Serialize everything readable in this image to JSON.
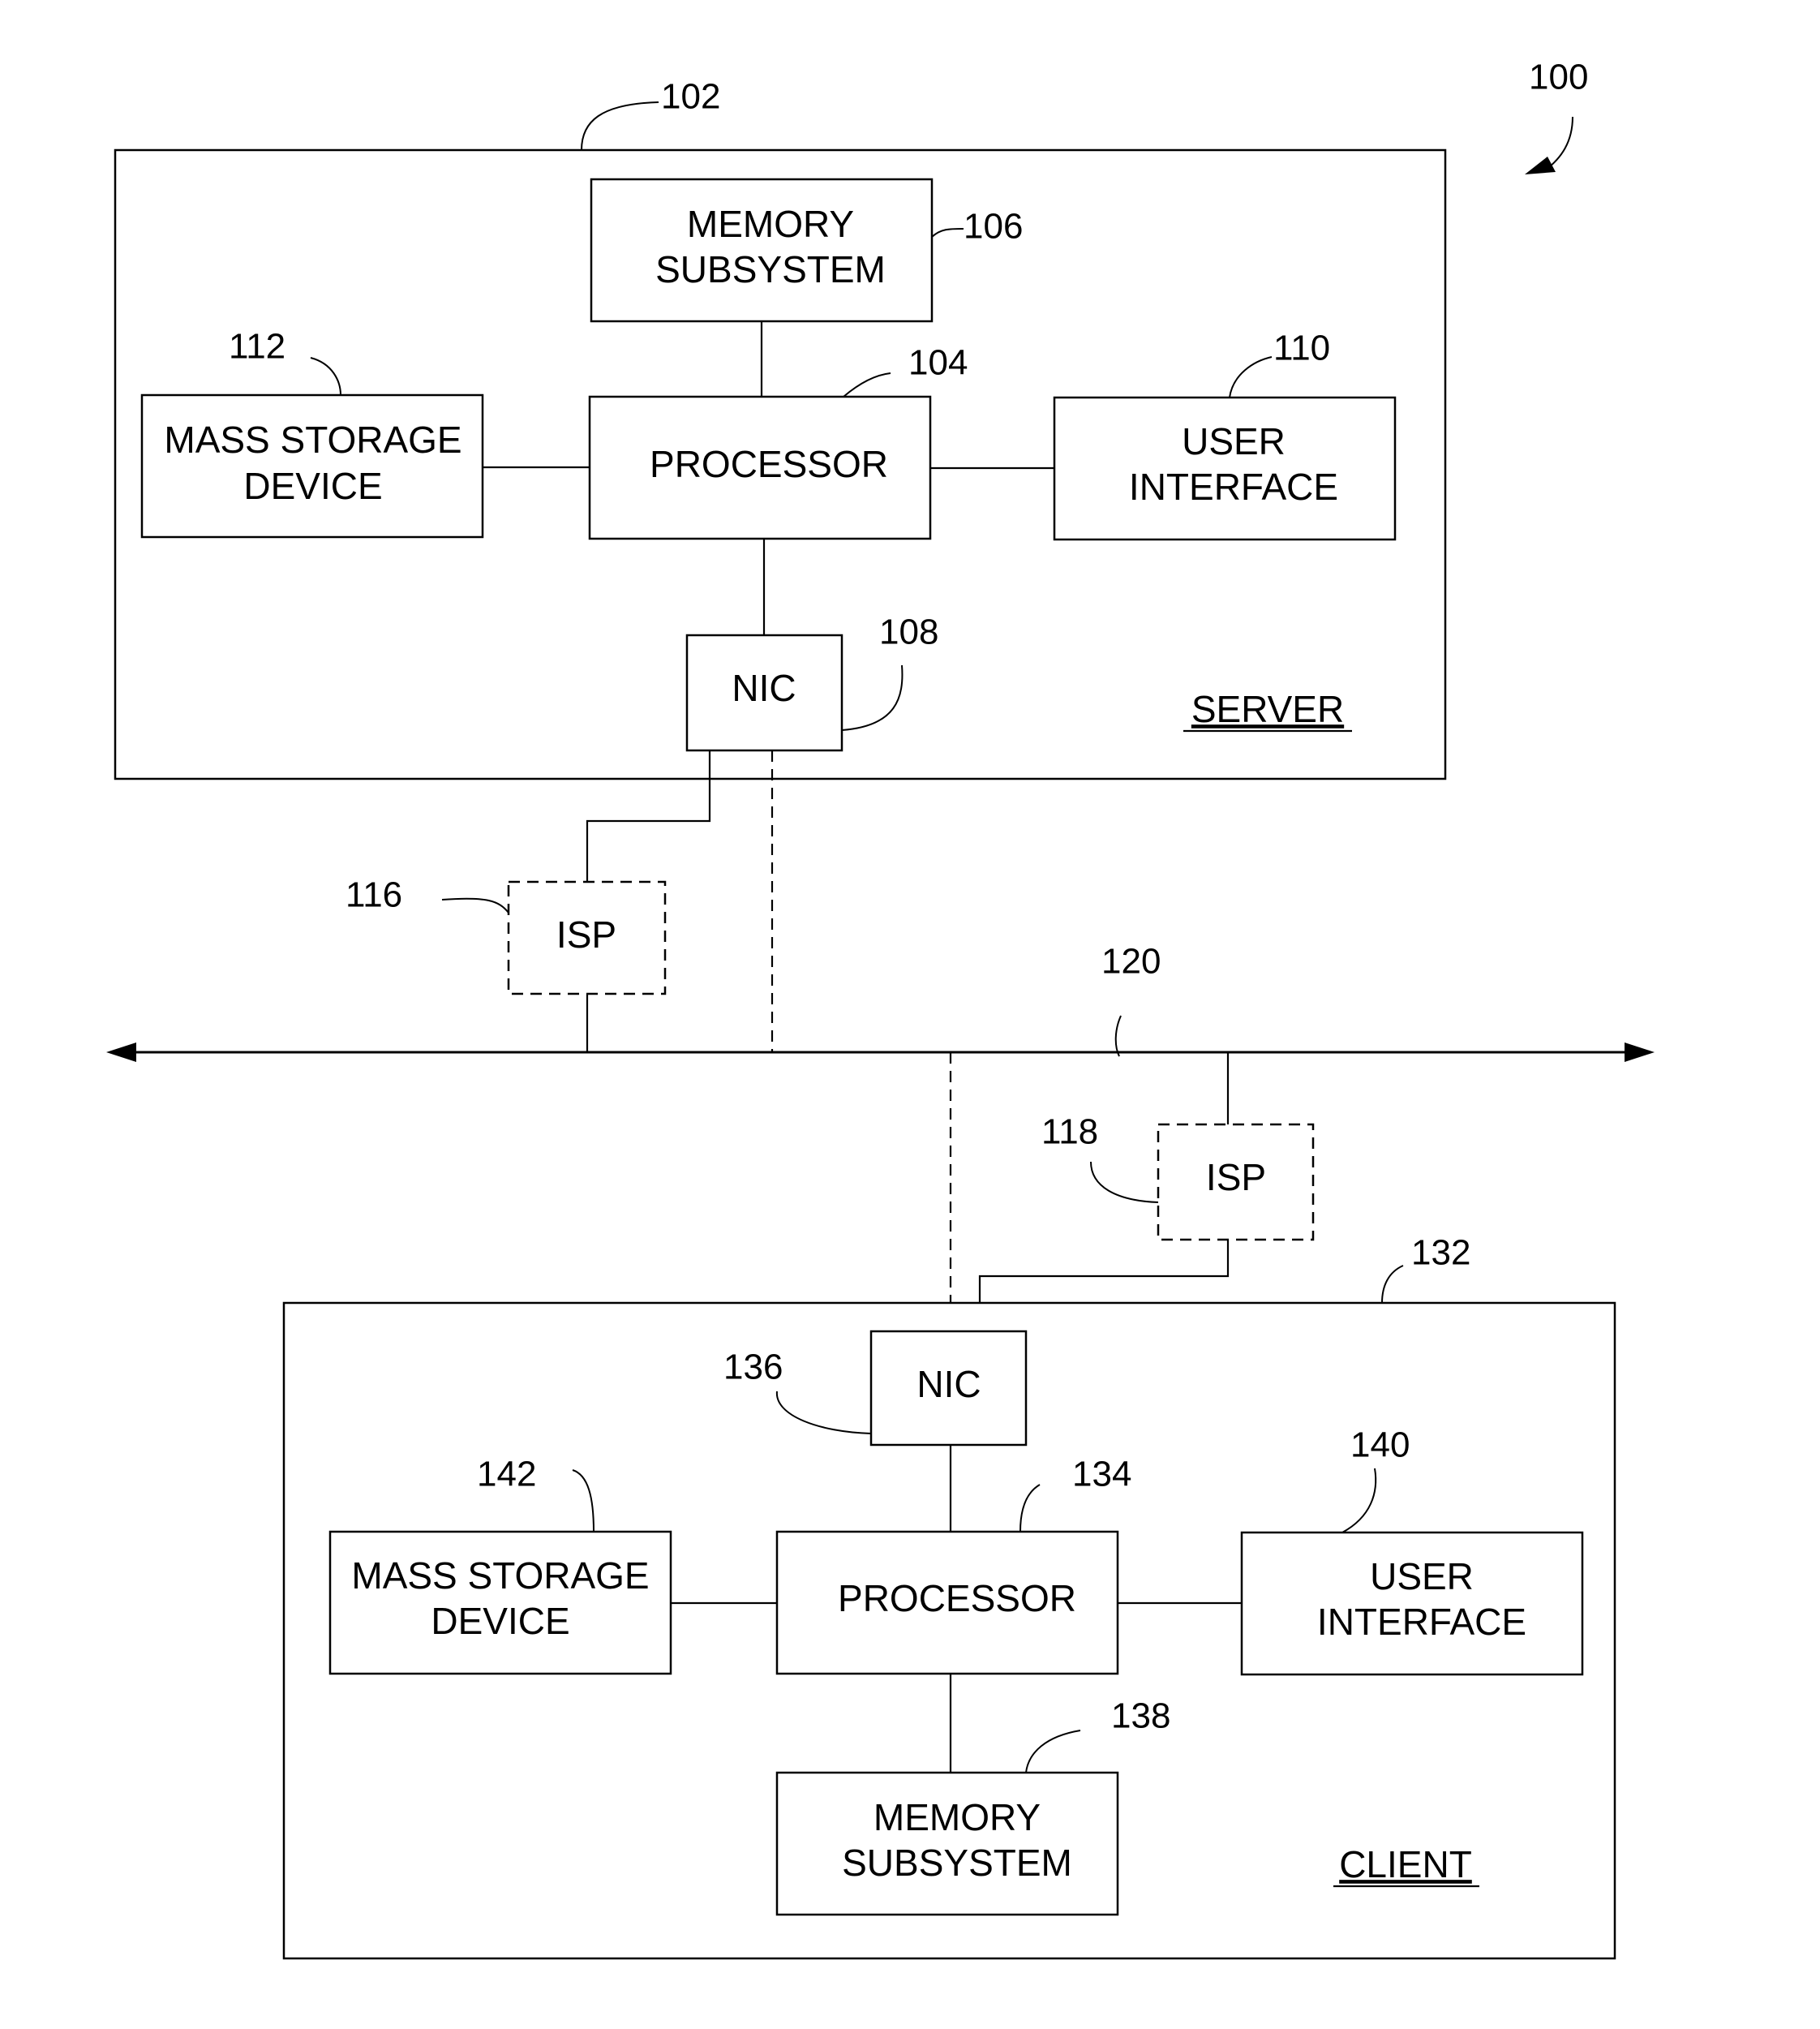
{
  "figure": {
    "ref": "100",
    "network_ref": "120"
  },
  "server": {
    "ref": "102",
    "title": "SERVER",
    "memory": {
      "ref": "106",
      "line1": "MEMORY",
      "line2": "SUBSYSTEM"
    },
    "processor": {
      "ref": "104",
      "label": "PROCESSOR"
    },
    "mass_storage": {
      "ref": "112",
      "line1": "MASS STORAGE",
      "line2": "DEVICE"
    },
    "user_interface": {
      "ref": "110",
      "line1": "USER",
      "line2": "INTERFACE"
    },
    "nic": {
      "ref": "108",
      "label": "NIC"
    }
  },
  "isp_server": {
    "ref": "116",
    "label": "ISP"
  },
  "isp_client": {
    "ref": "118",
    "label": "ISP"
  },
  "client": {
    "ref": "132",
    "title": "CLIENT",
    "nic": {
      "ref": "136",
      "label": "NIC"
    },
    "processor": {
      "ref": "134",
      "label": "PROCESSOR"
    },
    "mass_storage": {
      "ref": "142",
      "line1": "MASS STORAGE",
      "line2": "DEVICE"
    },
    "user_interface": {
      "ref": "140",
      "line1": "USER",
      "line2": "INTERFACE"
    },
    "memory": {
      "ref": "138",
      "line1": "MEMORY",
      "line2": "SUBSYSTEM"
    }
  }
}
